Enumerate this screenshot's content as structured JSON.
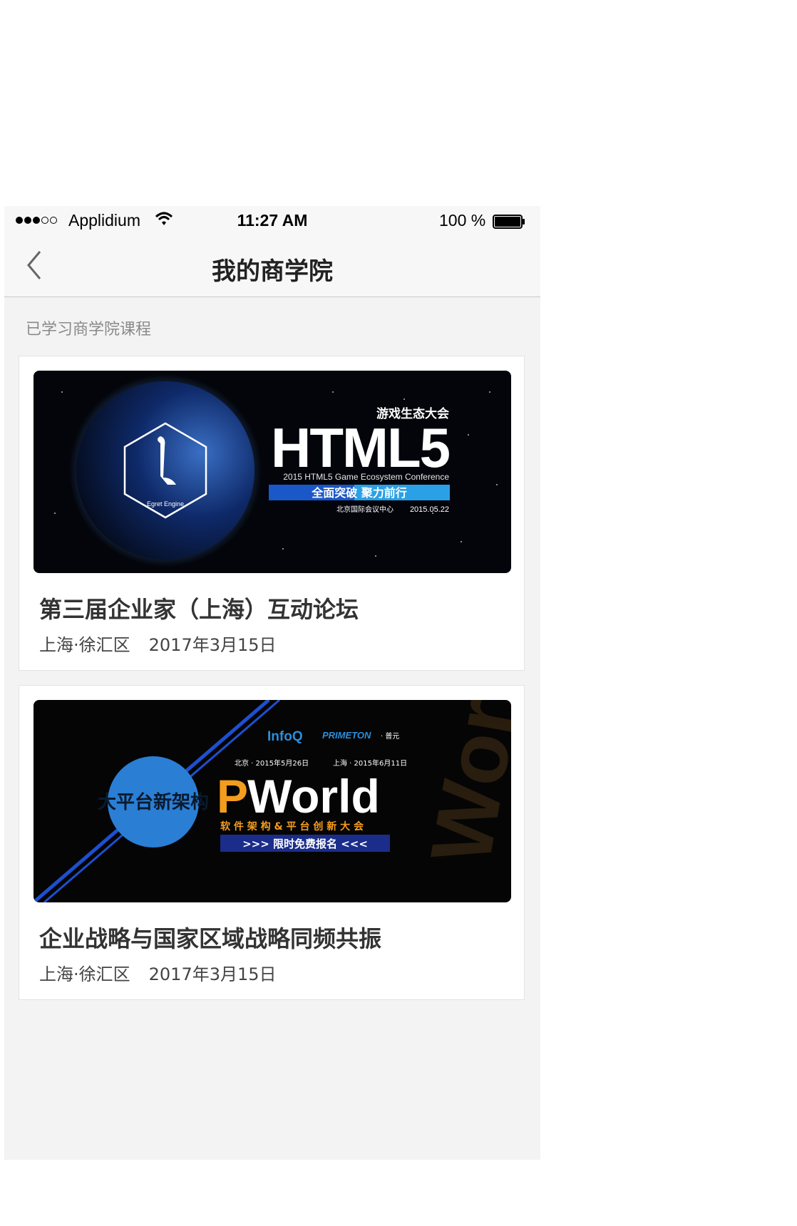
{
  "status_bar": {
    "carrier": "Applidium",
    "time": "11:27 AM",
    "battery_percent": "100 %",
    "signal_bars_filled": 3,
    "signal_bars_total": 5
  },
  "nav": {
    "title": "我的商学院",
    "back_icon": "chevron-left-icon"
  },
  "section_label": "已学习商学院课程",
  "courses": [
    {
      "title": "第三届企业家（上海）互动论坛",
      "location": "上海·徐汇区",
      "date": "2017年3月15日",
      "banner": {
        "big_title": "HTML5",
        "header_text": "游戏生态大会",
        "subtitle": "2015 HTML5 Game Ecosystem Conference",
        "slogan": "全面突破   聚力前行",
        "venue": "北京国际会议中心",
        "event_date": "2015.05.22",
        "logo_label": "Egret Engine"
      }
    },
    {
      "title": "企业战略与国家区域战略同频共振",
      "location": "上海·徐汇区",
      "date": "2017年3月15日",
      "banner": {
        "brand_left": "InfoQ",
        "brand_right": "PRIMETON",
        "brand_right_cn": "· 普元",
        "city_1": "北京 · 2015年5月26日",
        "city_2": "上海 · 2015年6月11日",
        "big_title_p": "P",
        "big_title_rest": "World",
        "tagline": "软 件 架 构 & 平 台 创 新 大 会",
        "cta": ">>> 限时免费报名 <<<",
        "circle_text": "大平台新架构"
      }
    }
  ],
  "colors": {
    "background": "#f3f3f3",
    "navbar": "#f7f7f7",
    "accent_blue": "#2a8fdc",
    "accent_orange": "#f49c1e"
  }
}
